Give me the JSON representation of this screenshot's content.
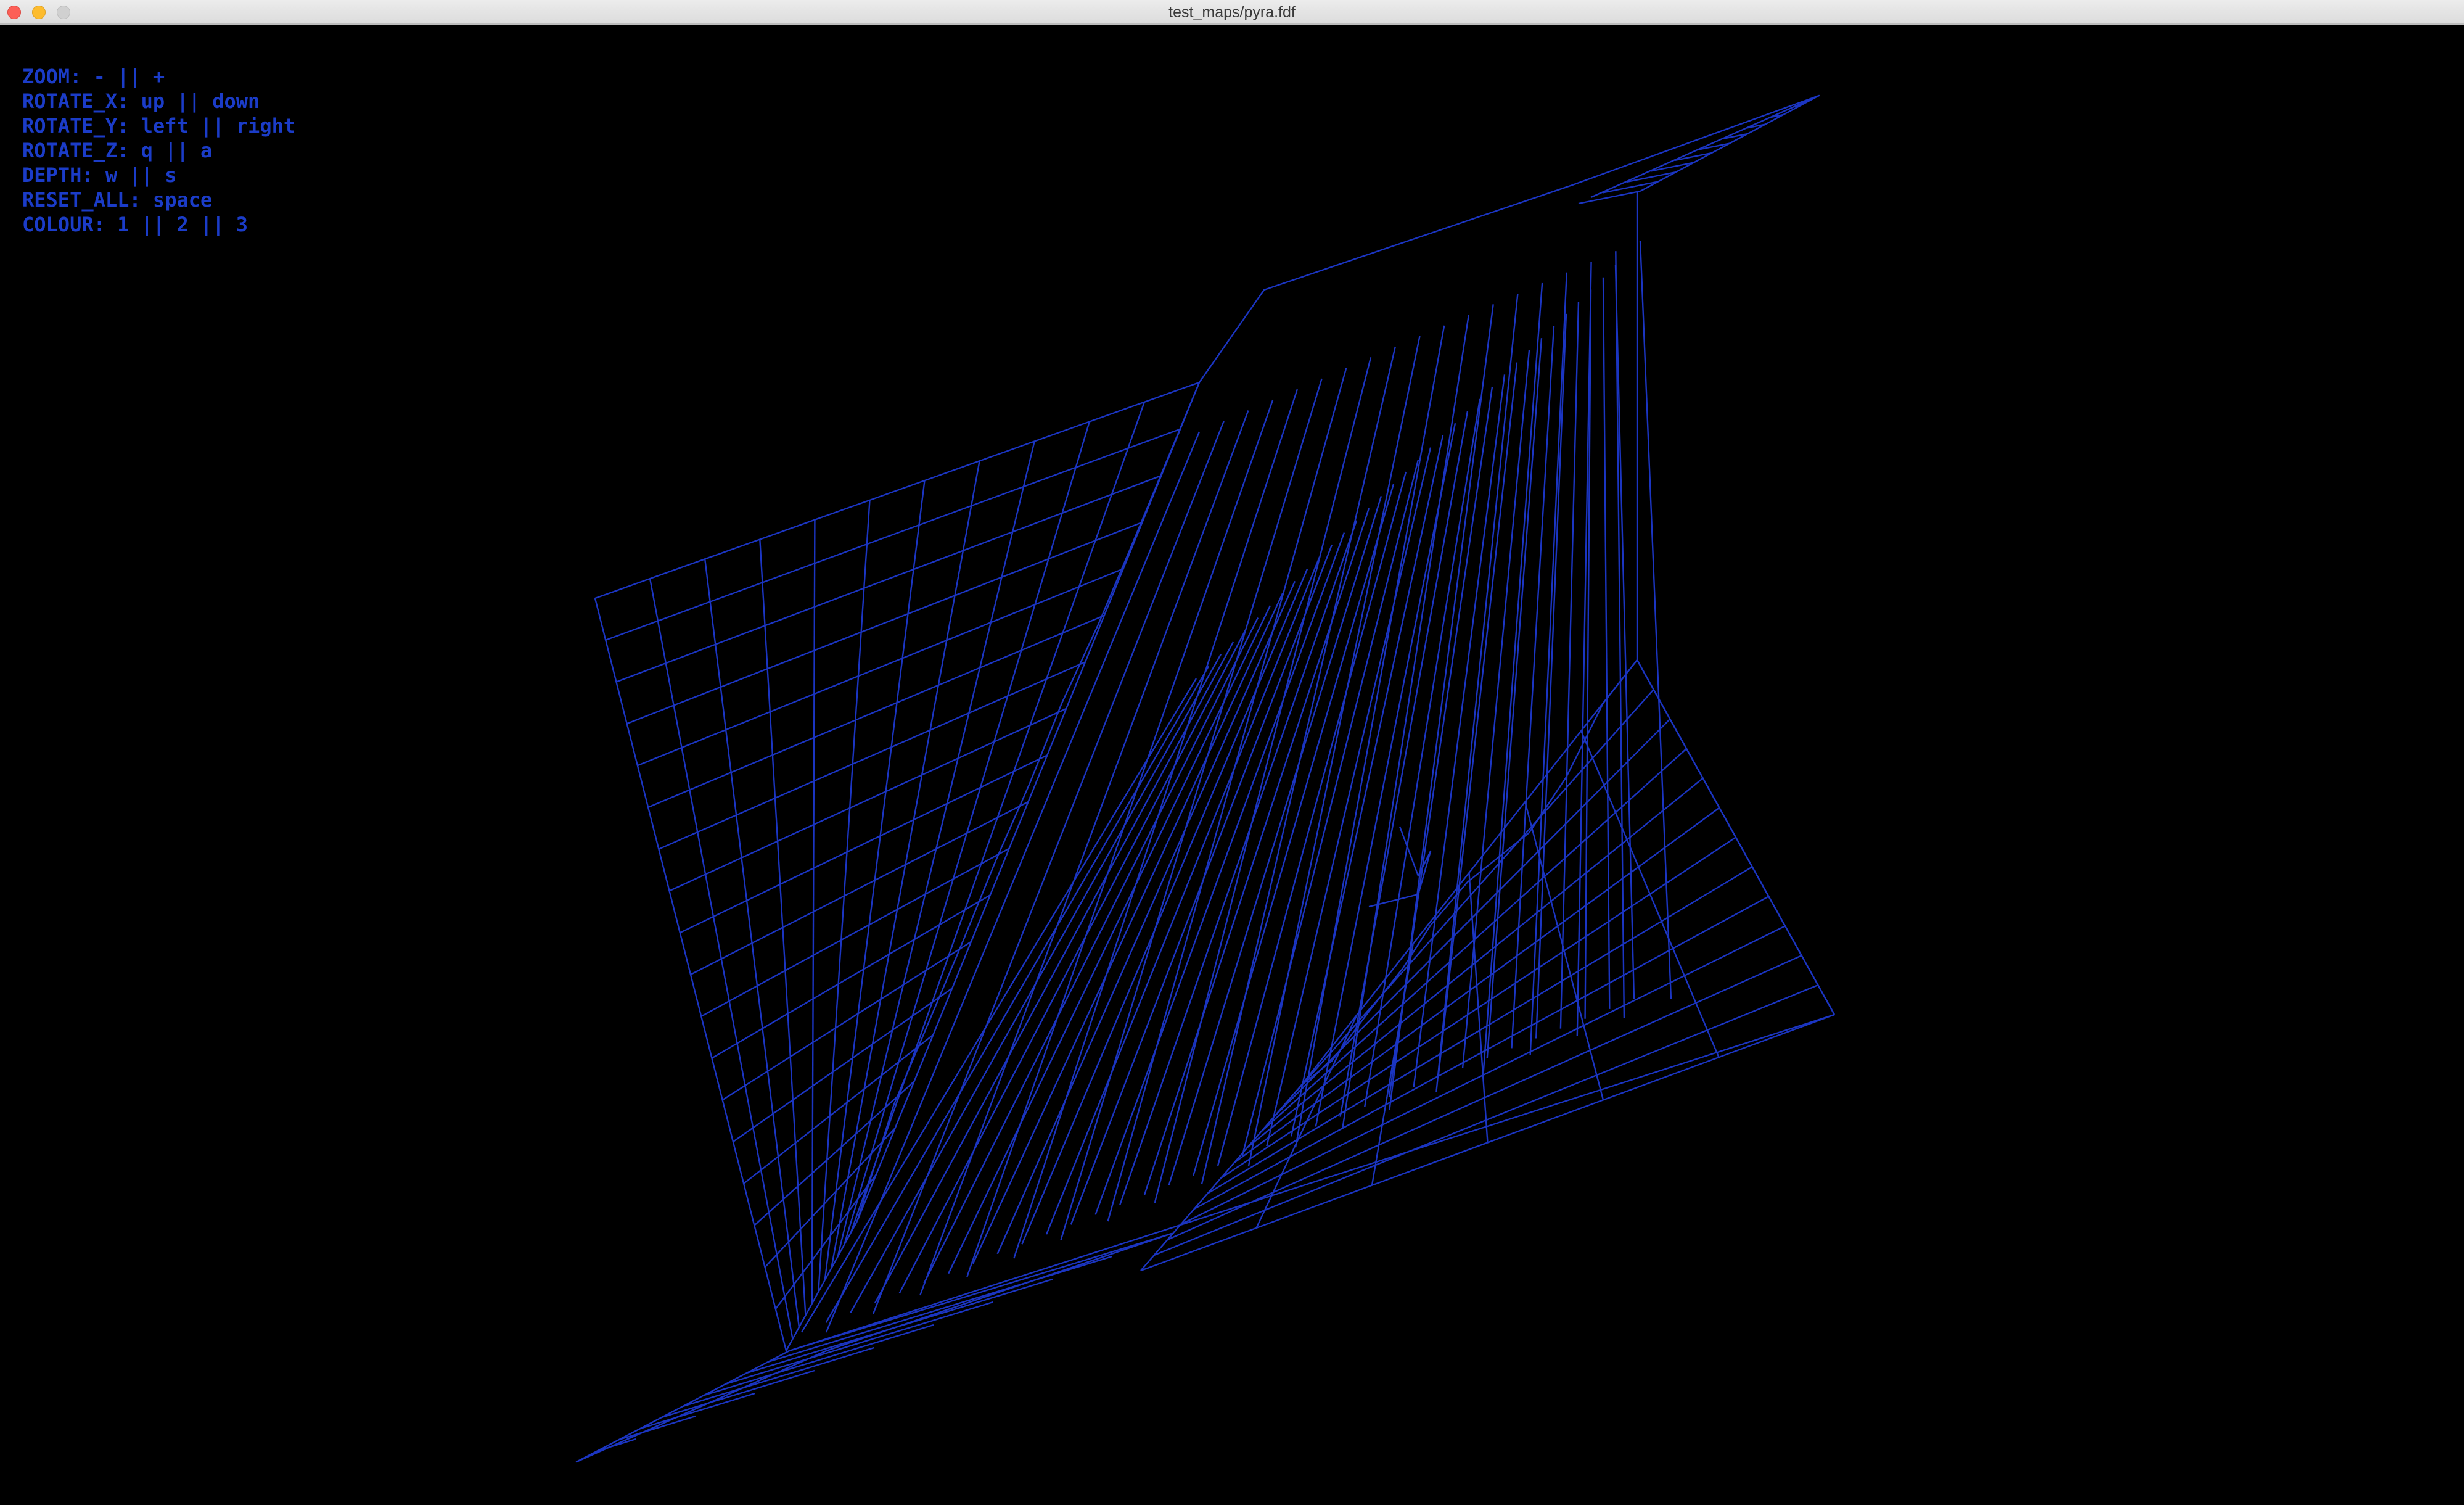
{
  "window": {
    "title": "test_maps/pyra.fdf"
  },
  "controls": [
    {
      "label": "ZOOM:",
      "keys": "- || +"
    },
    {
      "label": "ROTATE_X:",
      "keys": "up || down"
    },
    {
      "label": "ROTATE_Y:",
      "keys": "left || right"
    },
    {
      "label": "ROTATE_Z:",
      "keys": "q || a"
    },
    {
      "label": "DEPTH:",
      "keys": "w || s"
    },
    {
      "label": "RESET_ALL:",
      "keys": "space"
    },
    {
      "label": "COLOUR:",
      "keys": "1 || 2 || 3"
    }
  ],
  "colors": {
    "background": "#000000",
    "wireframe": "#1b35c2",
    "text": "#1b3cc8"
  }
}
